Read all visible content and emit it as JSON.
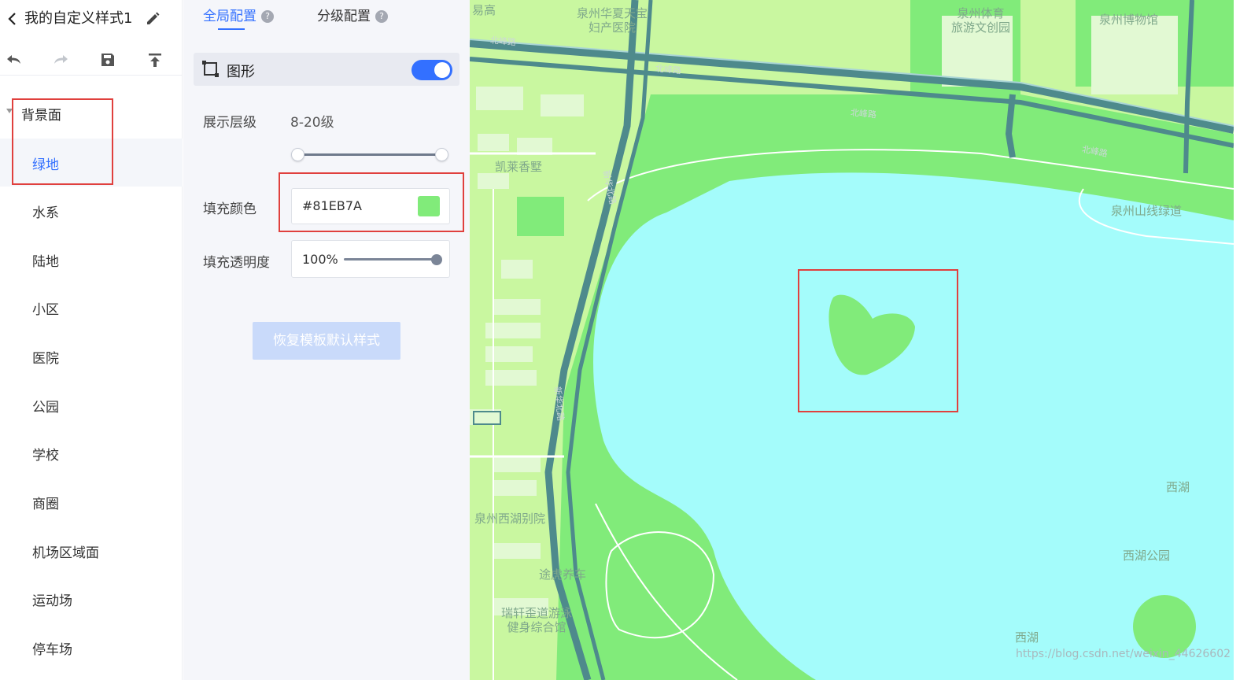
{
  "header": {
    "title": "我的自定义样式1"
  },
  "sidebar": {
    "group_label": "背景面",
    "items": [
      {
        "label": "绿地",
        "active": true
      },
      {
        "label": "水系"
      },
      {
        "label": "陆地"
      },
      {
        "label": "小区"
      },
      {
        "label": "医院"
      },
      {
        "label": "公园"
      },
      {
        "label": "学校"
      },
      {
        "label": "商圈"
      },
      {
        "label": "机场区域面"
      },
      {
        "label": "运动场"
      },
      {
        "label": "停车场"
      }
    ]
  },
  "panel": {
    "tabs": [
      {
        "label": "全局配置",
        "active": true
      },
      {
        "label": "分级配置"
      }
    ],
    "shape": {
      "label": "图形",
      "enabled": true
    },
    "display_level": {
      "label": "展示层级",
      "value": "8-20级",
      "min": 8,
      "max": 20
    },
    "fill_color": {
      "label": "填充颜色",
      "value": "#81EB7A"
    },
    "fill_opacity": {
      "label": "填充透明度",
      "value": "100%",
      "fraction": 1.0
    },
    "reset_label": "恢复模板默认样式"
  },
  "map": {
    "labels": {
      "hospital": "泉州华夏天宝\n妇产医院",
      "sports": "泉州体育\n旅游文创园",
      "museum": "泉州博物馆",
      "kaile": "凯莱香墅",
      "greenway": "泉州山线绿道",
      "xihu1": "西湖",
      "xihu_park": "西湖公园",
      "xihu2": "西湖",
      "villa": "泉州西湖别院",
      "tuhu": "途虎养车",
      "ruixuan": "瑞轩歪道游泳\n健身综合馆",
      "yigao": "易高"
    },
    "roads": {
      "r1": "北峰路",
      "r2": "北峰路",
      "r3": "北峰路",
      "r4": "北峰路",
      "r5": "新华北路",
      "r6": "新华北路"
    },
    "watermark": "https://blog.csdn.net/weixin_44626602",
    "colors": {
      "green": "#81EB7A",
      "water": "#A4FCFB",
      "land": "#C9F7A0",
      "road": "#4E8A8C",
      "highlight": "#E0403D"
    }
  },
  "icons": [
    "chevron-left-icon",
    "pencil-icon",
    "undo-icon",
    "redo-icon",
    "save-icon",
    "publish-icon",
    "caret-down-icon",
    "help-icon",
    "rectangle-shape-icon"
  ]
}
